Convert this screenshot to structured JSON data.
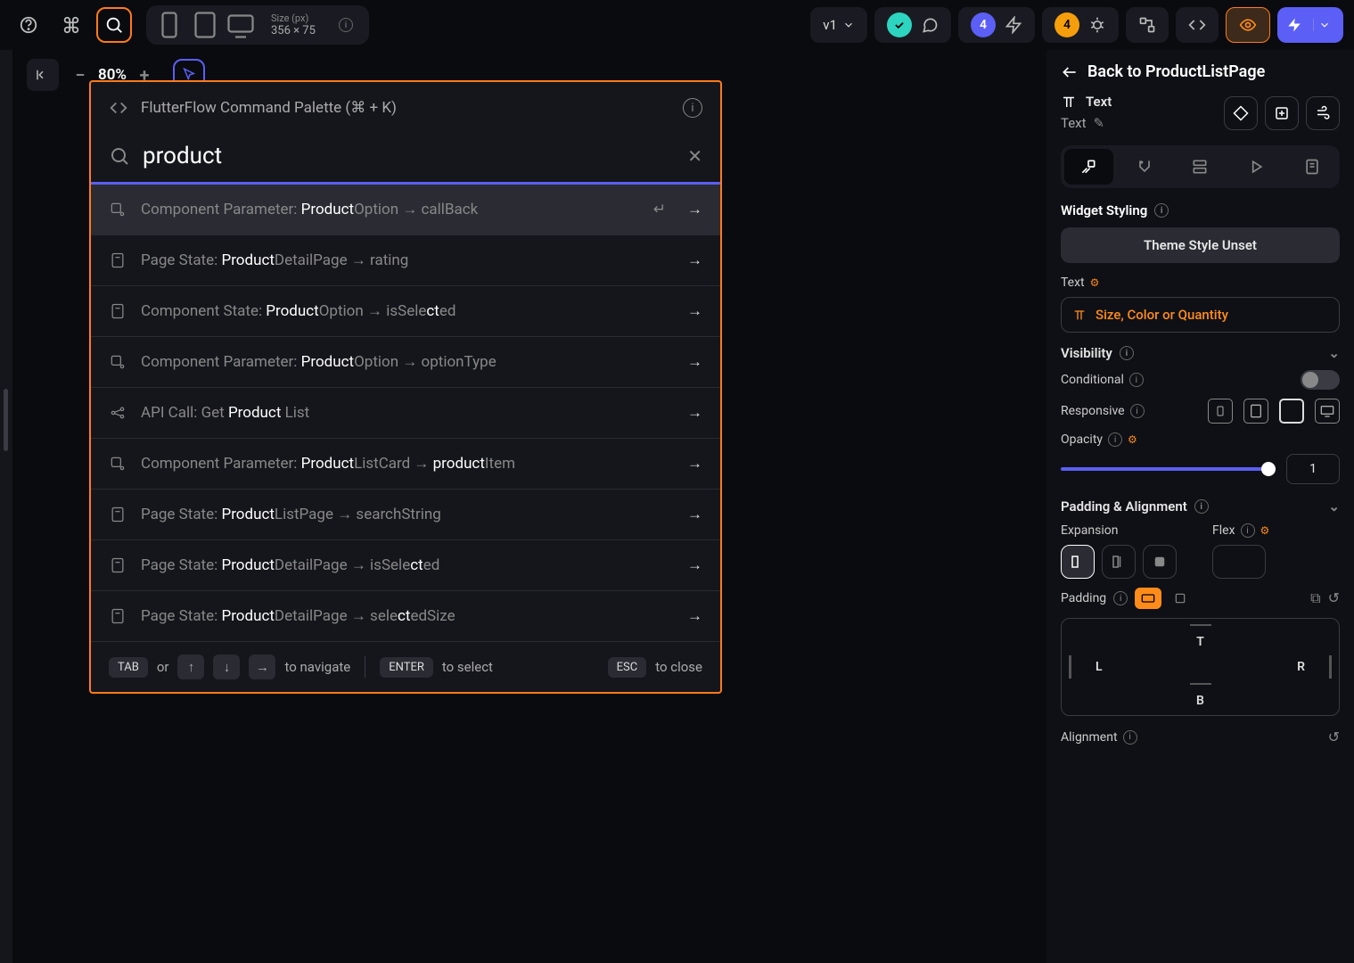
{
  "topbar": {
    "version": "v1",
    "size_label": "Size (px)",
    "size_value": "356 × 75",
    "badge_blue": "4",
    "badge_orange": "4"
  },
  "secondbar": {
    "zoom": "80%"
  },
  "palette": {
    "title": "FlutterFlow Command Palette (⌘ + K)",
    "query": "product",
    "results": [
      {
        "prefix": "Component Parameter: ",
        "hl": "Product",
        "mid": "Option → ",
        "suffix": "callBack",
        "icon": "param",
        "selected": true
      },
      {
        "prefix": "Page State: ",
        "hl": "Product",
        "mid": "DetailPage → ",
        "suffix": "rating",
        "icon": "page"
      },
      {
        "prefix": "Component State: ",
        "hl": "Product",
        "mid": "Option → isSele",
        "hl2": "ct",
        "suffix": "ed",
        "icon": "page"
      },
      {
        "prefix": "Component Parameter: ",
        "hl": "Product",
        "mid": "Option → ",
        "suffix": "optionType",
        "icon": "param"
      },
      {
        "prefix": "API Call: Get ",
        "hl": "Product",
        "mid": " ",
        "suffix": "List",
        "icon": "api"
      },
      {
        "prefix": "Component Parameter: ",
        "hl": "Product",
        "mid": "ListCard → ",
        "hl2": "product",
        "suffix": "Item",
        "icon": "param"
      },
      {
        "prefix": "Page State: ",
        "hl": "Product",
        "mid": "ListPage → ",
        "suffix": "searchString",
        "icon": "page"
      },
      {
        "prefix": "Page State: ",
        "hl": "Product",
        "mid": "DetailPage → isSele",
        "hl2": "ct",
        "suffix": "ed",
        "icon": "page"
      },
      {
        "prefix": "Page State: ",
        "hl": "Product",
        "mid": "DetailPage → sele",
        "hl2": "ct",
        "suffix": "edSize",
        "icon": "page"
      }
    ],
    "footer": {
      "tab": "TAB",
      "or": "or",
      "nav": "to navigate",
      "enter": "ENTER",
      "select": "to select",
      "esc": "ESC",
      "close": "to close"
    }
  },
  "sidebar": {
    "back": "Back to ProductListPage",
    "widget_type": "Text",
    "widget_name": "Text",
    "styling_title": "Widget Styling",
    "theme_btn": "Theme Style Unset",
    "text_label": "Text",
    "text_value": "Size, Color or Quantity",
    "visibility": "Visibility",
    "conditional": "Conditional",
    "responsive": "Responsive",
    "opacity": "Opacity",
    "opacity_value": "1",
    "padding_section": "Padding & Alignment",
    "expansion": "Expansion",
    "flex": "Flex",
    "padding": "Padding",
    "pad_t": "T",
    "pad_b": "B",
    "pad_l": "L",
    "pad_r": "R",
    "alignment": "Alignment"
  }
}
